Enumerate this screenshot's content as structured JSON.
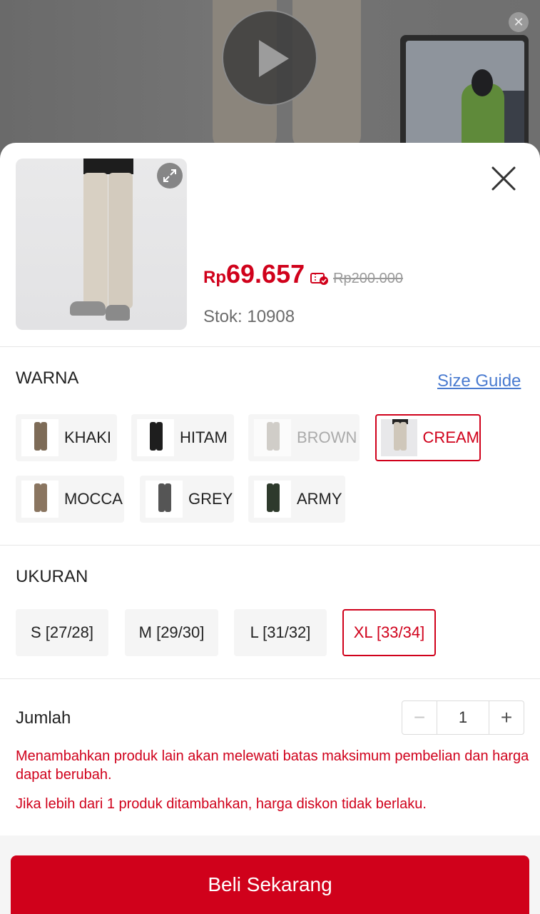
{
  "video": {
    "close_symbol": "✕"
  },
  "product": {
    "price_currency": "Rp",
    "price_value": "69.657",
    "price_original": "Rp200.000",
    "stock_text": "Stok: 10908"
  },
  "color_section": {
    "title": "WARNA",
    "size_guide_label": "Size Guide",
    "options": [
      {
        "label": "KHAKI",
        "state": "normal",
        "swatch": "#7d6b57"
      },
      {
        "label": "HITAM",
        "state": "normal",
        "swatch": "#1e1e1e"
      },
      {
        "label": "BROWN",
        "state": "disabled",
        "swatch": "#b9b3ab"
      },
      {
        "label": "CREAM",
        "state": "selected",
        "swatch": "#cfc7ba"
      },
      {
        "label": "MOCCA",
        "state": "normal",
        "swatch": "#8a7560"
      },
      {
        "label": "GREY",
        "state": "normal",
        "swatch": "#555555"
      },
      {
        "label": "ARMY",
        "state": "normal",
        "swatch": "#2e3a2c"
      }
    ]
  },
  "size_section": {
    "title": "UKURAN",
    "options": [
      {
        "label": "S [27/28]",
        "state": "normal"
      },
      {
        "label": "M [29/30]",
        "state": "normal"
      },
      {
        "label": "L [31/32]",
        "state": "normal"
      },
      {
        "label": "XL [33/34]",
        "state": "selected"
      }
    ]
  },
  "quantity": {
    "label": "Jumlah",
    "value": "1",
    "minus_symbol": "−",
    "plus_symbol": "+",
    "warning_1": "Menambahkan produk lain akan melewati batas maksimum pembelian dan harga dapat berubah.",
    "warning_2": "Jika lebih dari 1 produk ditambahkan, harga diskon tidak berlaku."
  },
  "actions": {
    "buy_label": "Beli Sekarang"
  },
  "colors": {
    "accent": "#d0011b",
    "link": "#4a7bd0"
  }
}
